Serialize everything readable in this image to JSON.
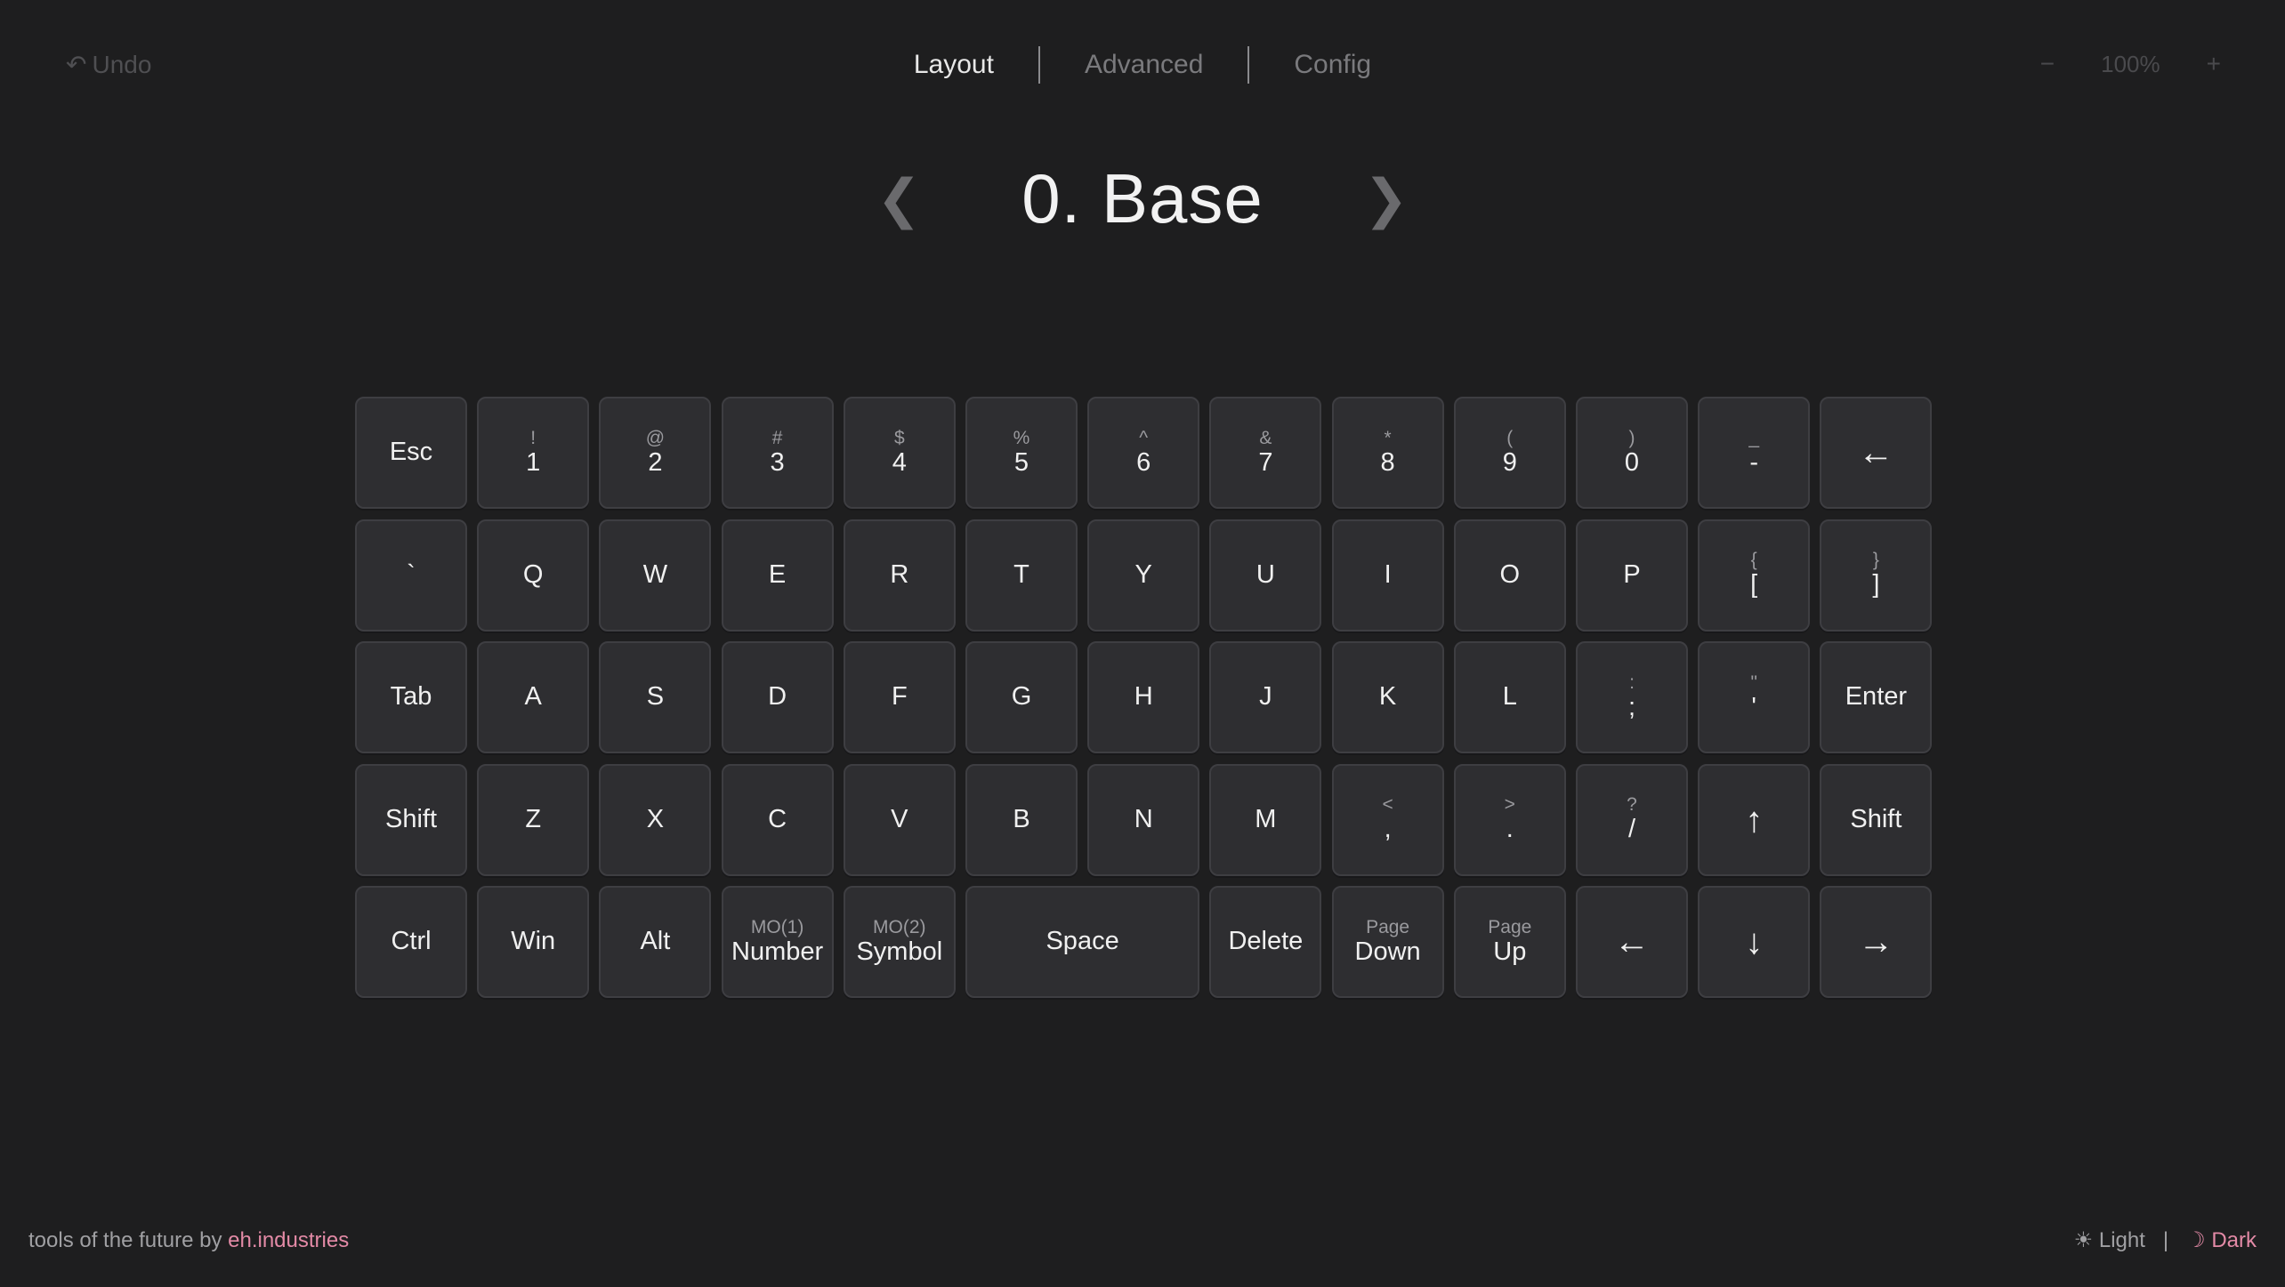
{
  "header": {
    "undo_icon": "↶",
    "undo_label": "Undo",
    "tabs": [
      {
        "label": "Layout",
        "active": true
      },
      {
        "label": "Advanced",
        "active": false
      },
      {
        "label": "Config",
        "active": false
      }
    ],
    "zoom": {
      "minus": "−",
      "level": "100%",
      "plus": "+"
    }
  },
  "layer": {
    "prev": "❮",
    "title": "0. Base",
    "next": "❯"
  },
  "keyboard": {
    "rows": [
      [
        {
          "sub": "",
          "main": "Esc",
          "name": "esc"
        },
        {
          "sub": "!",
          "main": "1",
          "name": "1"
        },
        {
          "sub": "@",
          "main": "2",
          "name": "2"
        },
        {
          "sub": "#",
          "main": "3",
          "name": "3"
        },
        {
          "sub": "$",
          "main": "4",
          "name": "4"
        },
        {
          "sub": "%",
          "main": "5",
          "name": "5"
        },
        {
          "sub": "^",
          "main": "6",
          "name": "6"
        },
        {
          "sub": "&",
          "main": "7",
          "name": "7"
        },
        {
          "sub": "*",
          "main": "8",
          "name": "8"
        },
        {
          "sub": "(",
          "main": "9",
          "name": "9"
        },
        {
          "sub": ")",
          "main": "0",
          "name": "0"
        },
        {
          "sub": "_",
          "main": "-",
          "name": "minus"
        },
        {
          "sub": "",
          "main": "←",
          "name": "backspace",
          "arrow": true
        }
      ],
      [
        {
          "sub": "",
          "main": "`",
          "name": "grave"
        },
        {
          "sub": "",
          "main": "Q",
          "name": "q"
        },
        {
          "sub": "",
          "main": "W",
          "name": "w"
        },
        {
          "sub": "",
          "main": "E",
          "name": "e"
        },
        {
          "sub": "",
          "main": "R",
          "name": "r"
        },
        {
          "sub": "",
          "main": "T",
          "name": "t"
        },
        {
          "sub": "",
          "main": "Y",
          "name": "y"
        },
        {
          "sub": "",
          "main": "U",
          "name": "u"
        },
        {
          "sub": "",
          "main": "I",
          "name": "i"
        },
        {
          "sub": "",
          "main": "O",
          "name": "o"
        },
        {
          "sub": "",
          "main": "P",
          "name": "p"
        },
        {
          "sub": "{",
          "main": "[",
          "name": "left-bracket"
        },
        {
          "sub": "}",
          "main": "]",
          "name": "right-bracket"
        }
      ],
      [
        {
          "sub": "",
          "main": "Tab",
          "name": "tab"
        },
        {
          "sub": "",
          "main": "A",
          "name": "a"
        },
        {
          "sub": "",
          "main": "S",
          "name": "s"
        },
        {
          "sub": "",
          "main": "D",
          "name": "d"
        },
        {
          "sub": "",
          "main": "F",
          "name": "f"
        },
        {
          "sub": "",
          "main": "G",
          "name": "g"
        },
        {
          "sub": "",
          "main": "H",
          "name": "h"
        },
        {
          "sub": "",
          "main": "J",
          "name": "j"
        },
        {
          "sub": "",
          "main": "K",
          "name": "k"
        },
        {
          "sub": "",
          "main": "L",
          "name": "l"
        },
        {
          "sub": ":",
          "main": ";",
          "name": "semicolon"
        },
        {
          "sub": "\"",
          "main": "'",
          "name": "quote"
        },
        {
          "sub": "",
          "main": "Enter",
          "name": "enter"
        }
      ],
      [
        {
          "sub": "",
          "main": "Shift",
          "name": "left-shift"
        },
        {
          "sub": "",
          "main": "Z",
          "name": "z"
        },
        {
          "sub": "",
          "main": "X",
          "name": "x"
        },
        {
          "sub": "",
          "main": "C",
          "name": "c"
        },
        {
          "sub": "",
          "main": "V",
          "name": "v"
        },
        {
          "sub": "",
          "main": "B",
          "name": "b"
        },
        {
          "sub": "",
          "main": "N",
          "name": "n"
        },
        {
          "sub": "",
          "main": "M",
          "name": "m"
        },
        {
          "sub": "<",
          "main": ",",
          "name": "comma"
        },
        {
          "sub": ">",
          "main": ".",
          "name": "period"
        },
        {
          "sub": "?",
          "main": "/",
          "name": "slash"
        },
        {
          "sub": "",
          "main": "↑",
          "name": "up-arrow",
          "arrow": true
        },
        {
          "sub": "",
          "main": "Shift",
          "name": "right-shift"
        }
      ],
      [
        {
          "sub": "",
          "main": "Ctrl",
          "name": "ctrl"
        },
        {
          "sub": "",
          "main": "Win",
          "name": "win"
        },
        {
          "sub": "",
          "main": "Alt",
          "name": "alt"
        },
        {
          "sub": "MO(1)",
          "main": "Number",
          "name": "number-layer"
        },
        {
          "sub": "MO(2)",
          "main": "Symbol",
          "name": "symbol-layer"
        },
        {
          "sub": "",
          "main": "Space",
          "name": "space",
          "units": 2
        },
        {
          "sub": "",
          "main": "Delete",
          "name": "delete"
        },
        {
          "sub": "Page",
          "main": "Down",
          "name": "page-down"
        },
        {
          "sub": "Page",
          "main": "Up",
          "name": "page-up"
        },
        {
          "sub": "",
          "main": "←",
          "name": "left-arrow",
          "arrow": true
        },
        {
          "sub": "",
          "main": "↓",
          "name": "down-arrow",
          "arrow": true
        },
        {
          "sub": "",
          "main": "→",
          "name": "right-arrow",
          "arrow": true
        }
      ]
    ]
  },
  "footer": {
    "prefix": "tools of the future by ",
    "brand": "eh.industries",
    "light_icon": "☀",
    "light_label": "Light",
    "separator": "|",
    "dark_icon": "☽",
    "dark_label": "Dark"
  }
}
